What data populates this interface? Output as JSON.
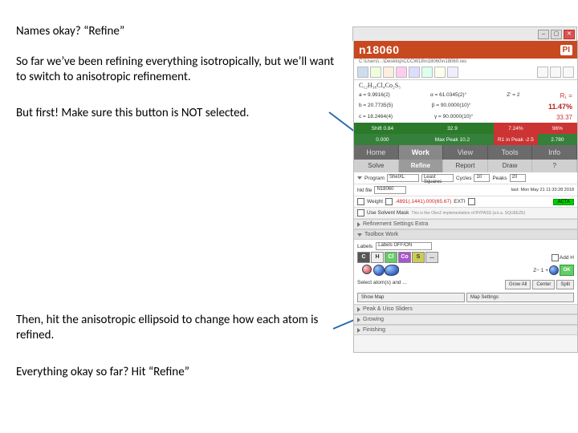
{
  "text": {
    "p1": "Names okay? “Refine”",
    "p2": "So far we’ve been refining everything isotropically, but we’ll want to switch to anisotropic refinement.",
    "p3": "But first! Make sure this button is NOT selected.",
    "p4": "Then, hit the anisotropic ellipsoid to change how each atom is refined.",
    "p5": "Everything okay so far? Hit “Refine”"
  },
  "app": {
    "title": "n18060",
    "pi": "PI",
    "path": "C:\\Users\\...\\Desktop\\CCCW18\\n18060\\n18060.res",
    "formula": "C₁₂H₃₆Cl₄Co₂S₅",
    "cell": {
      "a": "a = 9.9916(2)",
      "b": "b = 20.7735(5)",
      "c": "c = 18.2464(4)",
      "al": "α = 61.0345(2)°",
      "be": "β = 90.0000(10)°",
      "ga": "γ = 90.0000(10)°",
      "z": "Z' = 2",
      "vol": "",
      "r1_label": "R₁ =",
      "r1": "11.47%",
      "wr2": "33.37"
    },
    "stat": {
      "s1a": "0.84",
      "s1b": "32.9",
      "s1c": "7.24%",
      "s1d": "96%",
      "s2a": "0.000",
      "s2b_lbl": "Max Peak",
      "s2b": "10.2",
      "s2c_lbl": "R1 in Peak",
      "s2c": "-2.5",
      "s2d": "2.780"
    },
    "maintabs": [
      "Home",
      "Work",
      "View",
      "Tools",
      "Info"
    ],
    "maintab_active": 1,
    "subtabs": [
      "Solve",
      "Refine",
      "Report",
      "Draw",
      "?"
    ],
    "subtab_active": 1,
    "refine": {
      "prog": "Program",
      "prog_v": "ShelXL",
      "meth": "Least Squares",
      "cyc": "Cycles",
      "cyc_v": "10",
      "peaks": "Peaks",
      "peaks_v": "20",
      "hkl": "hkl file",
      "hkl_v": "N18060",
      "last": "last: Mon May 21 11:33:28 2018",
      "weight": "Weight",
      "weight_v": ".4891(.1441).000(65.67)",
      "exti": "EXTI",
      "acta": "ACTA",
      "mask": "Use Solvent Mask",
      "mask2": "This is like Olex2 implementation of BYPASS (a.k.a. SQUEEZE)",
      "extra": "Refinement Settings Extra"
    },
    "toolbox": {
      "title": "Toolbox Work",
      "labels": "Labels",
      "labels_v": "Labels OFF/ON",
      "elements": [
        "C",
        "H",
        "Cl",
        "Co",
        "S",
        "..."
      ],
      "add": "Add H",
      "z": "Z− 1 +",
      "sel": "Select atom(s) and ...",
      "grow": "Grow All",
      "center": "Center",
      "split": "Split",
      "showmap": "Show Map",
      "mapset": "Map Settings",
      "peak": "Peak & Uiso Sliders",
      "grow2": "Growing",
      "finish": "Finishing"
    }
  }
}
